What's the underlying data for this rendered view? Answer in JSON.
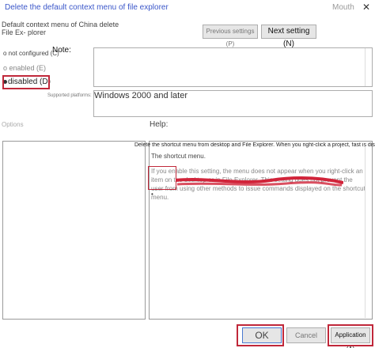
{
  "window": {
    "title": "Delete the default context menu of file explorer",
    "corner_label": "Mouth",
    "close_glyph": "✕",
    "setting_name": "Default context menu of China delete File Ex- plorer"
  },
  "nav": {
    "previous_label": "Previous settings (P)",
    "next_label": "Next setting (N)"
  },
  "radios": [
    {
      "label": "o not configured (C)"
    },
    {
      "label": "o enabled (E)"
    },
    {
      "label": "disabled (D)",
      "selected": true
    }
  ],
  "note": {
    "label": "Note:",
    "value": ""
  },
  "supported": {
    "label": "Supported platforms:",
    "value": "Windows 2000 and later"
  },
  "sections": {
    "options": "Options",
    "help": "Help:"
  },
  "help": {
    "line1": "Delete the shortcut menu from desktop and File Explorer. When you right-click a project, fast is displayed",
    "line2": "The shortcut menu.",
    "para": "If you enable this setting, the menu does not appear when you right-click an item on the desktop or in File Explorer. This setting does not prevent the user from using other methods to issue commands displayed on the shortcut menu.",
    "bullet": "•"
  },
  "buttons": {
    "ok": "OK",
    "cancel": "Cancel",
    "apply": "Application (A)"
  },
  "colors": {
    "highlight": "#c0283a",
    "title": "#3a56c9"
  }
}
